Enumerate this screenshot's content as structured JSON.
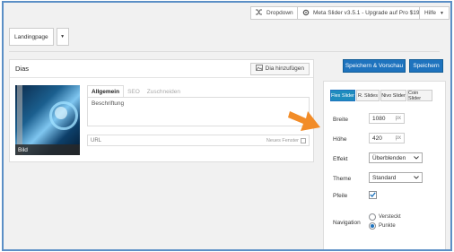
{
  "topbar": {
    "dropdown_label": "Dropdown",
    "upgrade_label": "Meta Slider v3.5.1 - Upgrade auf Pro $19",
    "help_label": "Hilfe",
    "help_caret": "▼"
  },
  "tabs": {
    "current": "Landingpage",
    "add_caret": "▼"
  },
  "slides": {
    "title": "Dias",
    "add_button": "Dia hinzufügen",
    "thumb_caption": "Bild",
    "tab_general": "Allgemein",
    "tab_seo": "SEO",
    "tab_crop": "Zuschneiden",
    "caption_placeholder": "Beschriftung",
    "url_placeholder": "URL",
    "new_window_label": "Neues Fenster"
  },
  "actions": {
    "save_preview": "Speichern & Vorschau",
    "save": "Speichern"
  },
  "settings": {
    "slider_types": [
      "Flex Slider",
      "R. Slides",
      "Nivo Slider",
      "Coin Slider"
    ],
    "width_label": "Breite",
    "width_value": "1080",
    "height_label": "Höhe",
    "height_value": "420",
    "unit": "px",
    "effect_label": "Effekt",
    "effect_value": "Überblenden",
    "theme_label": "Theme",
    "theme_value": "Standard",
    "arrows_label": "Pfeile",
    "arrows_checked": true,
    "navigation_label": "Navigation",
    "nav_option_hidden": "Versteckt",
    "nav_option_dots": "Punkte",
    "nav_selected": "Punkte"
  },
  "colors": {
    "primary_button": "#1e73be",
    "active_slider_tab": "#1e8cbe",
    "frame_border": "#5b8fc6",
    "arrow": "#f28c28"
  }
}
